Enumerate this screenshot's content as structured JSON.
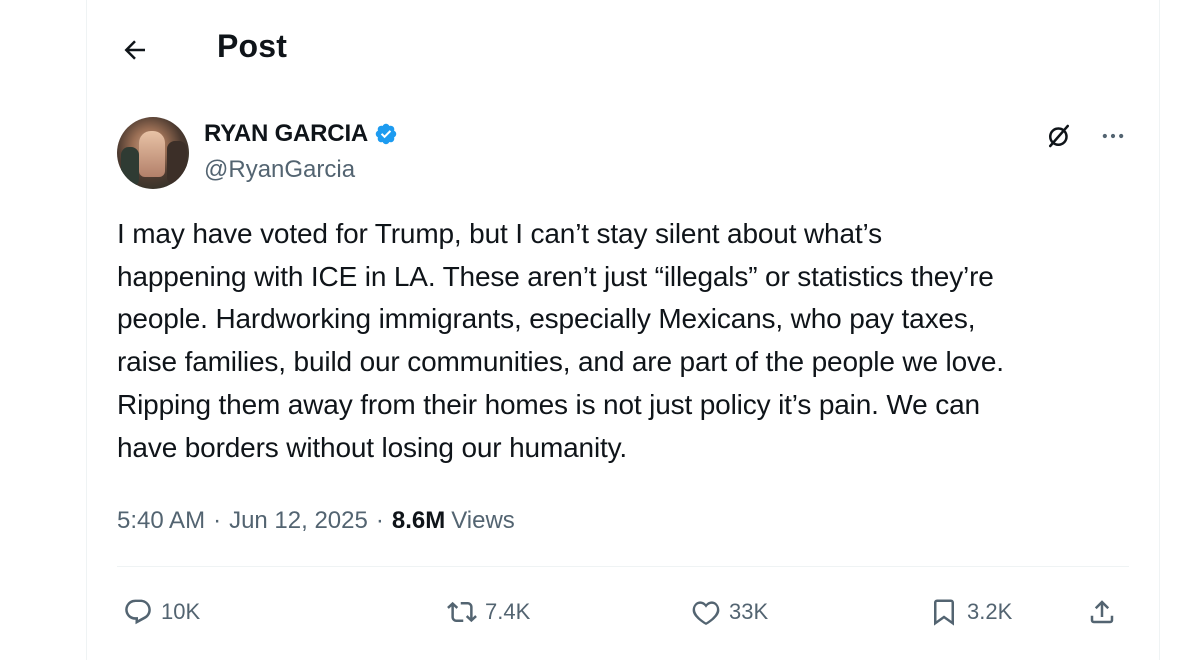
{
  "header": {
    "title": "Post"
  },
  "post": {
    "author": {
      "display_name": "RYAN GARCIA",
      "handle": "@RyanGarcia",
      "verified": true
    },
    "text": "I may have voted for Trump, but I can’t stay silent about what’s\nhappening with ICE in LA. These aren’t just “illegals” or statistics they’re\npeople. Hardworking immigrants, especially Mexicans, who pay taxes,\nraise families, build our communities, and are part of the people we love.\nRipping them away from their homes is not just policy it’s pain. We can\nhave borders without losing our humanity.",
    "time": "5:40 AM",
    "date": "Jun 12, 2025",
    "separator": "·",
    "views_count": "8.6M",
    "views_label": "Views"
  },
  "actions": {
    "replies": "10K",
    "reposts": "7.4K",
    "likes": "33K",
    "bookmarks": "3.2K"
  },
  "icons": {
    "back": "back-arrow-icon",
    "verified": "verified-badge-icon",
    "grok": "grok-icon",
    "more": "more-icon",
    "reply": "reply-icon",
    "repost": "repost-icon",
    "like": "like-icon",
    "bookmark": "bookmark-icon",
    "share": "share-icon"
  },
  "colors": {
    "text_primary": "#0f1419",
    "text_secondary": "#536471",
    "verified_blue": "#1d9bf0",
    "border": "#eff3f4"
  }
}
